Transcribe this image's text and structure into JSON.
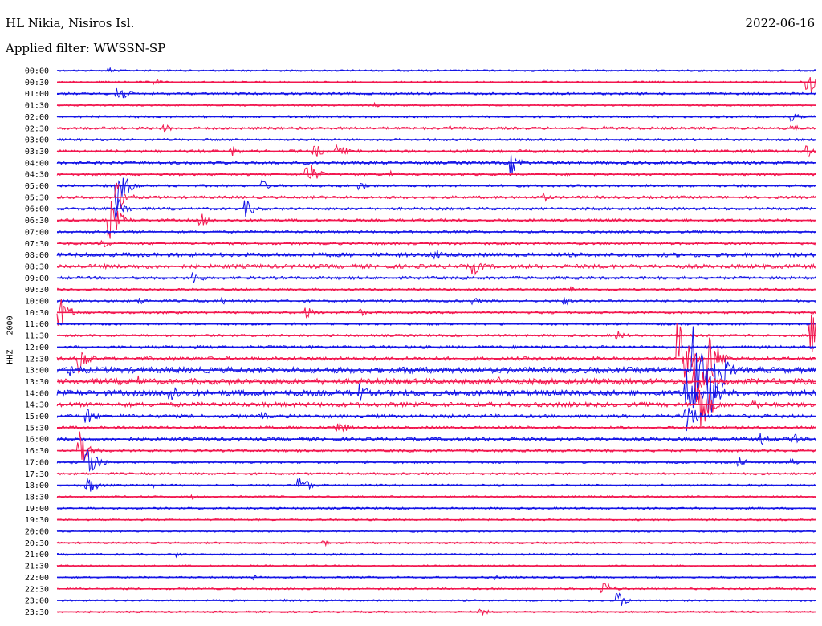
{
  "header": {
    "station": "HL Nikia, Nisiros Isl.",
    "date": "2022-06-16",
    "filter": "Applied filter: WWSSN-SP"
  },
  "colors": {
    "blue": "#1515e6",
    "red": "#f2174f"
  },
  "chart_data": {
    "type": "helicorder",
    "ylabel": "HHZ - 2000",
    "row_colors": [
      "blue",
      "red"
    ],
    "rows": [
      {
        "label": "00:00",
        "activity": 0.1,
        "events": [
          {
            "t": 0.07,
            "amp": 0.25
          }
        ]
      },
      {
        "label": "00:30",
        "activity": 0.12,
        "events": [
          {
            "t": 0.13,
            "amp": 0.25
          },
          {
            "t": 0.99,
            "amp": 1.6
          }
        ]
      },
      {
        "label": "01:00",
        "activity": 0.15,
        "events": [
          {
            "t": 0.08,
            "amp": 0.9
          }
        ]
      },
      {
        "label": "01:30",
        "activity": 0.1,
        "events": [
          {
            "t": 0.42,
            "amp": 0.2
          },
          {
            "t": 0.74,
            "amp": 0.15
          }
        ]
      },
      {
        "label": "02:00",
        "activity": 0.15,
        "events": [
          {
            "t": 0.97,
            "amp": 0.35
          }
        ]
      },
      {
        "label": "02:30",
        "activity": 0.18,
        "events": [
          {
            "t": 0.14,
            "amp": 0.4
          },
          {
            "t": 0.52,
            "amp": 0.2
          },
          {
            "t": 0.72,
            "amp": 0.2
          },
          {
            "t": 0.97,
            "amp": 0.3
          }
        ]
      },
      {
        "label": "03:00",
        "activity": 0.15,
        "events": []
      },
      {
        "label": "03:30",
        "activity": 0.22,
        "events": [
          {
            "t": 0.23,
            "amp": 0.5
          },
          {
            "t": 0.34,
            "amp": 0.6
          },
          {
            "t": 0.37,
            "amp": 0.6
          },
          {
            "t": 0.99,
            "amp": 0.5
          }
        ]
      },
      {
        "label": "04:00",
        "activity": 0.22,
        "events": [
          {
            "t": 0.6,
            "amp": 0.9
          }
        ]
      },
      {
        "label": "04:30",
        "activity": 0.18,
        "events": [
          {
            "t": 0.16,
            "amp": 0.2
          },
          {
            "t": 0.33,
            "amp": 1.2
          },
          {
            "t": 0.44,
            "amp": 0.3
          }
        ]
      },
      {
        "label": "05:00",
        "activity": 0.18,
        "events": [
          {
            "t": 0.08,
            "amp": 2.0
          },
          {
            "t": 0.27,
            "amp": 0.5
          },
          {
            "t": 0.4,
            "amp": 0.35
          }
        ]
      },
      {
        "label": "05:30",
        "activity": 0.2,
        "events": [
          {
            "t": 0.08,
            "amp": 1.4
          },
          {
            "t": 0.64,
            "amp": 0.4
          }
        ]
      },
      {
        "label": "06:00",
        "activity": 0.2,
        "events": [
          {
            "t": 0.08,
            "amp": 0.9
          },
          {
            "t": 0.25,
            "amp": 0.7
          }
        ]
      },
      {
        "label": "06:30",
        "activity": 0.22,
        "events": [
          {
            "t": 0.07,
            "amp": 1.9
          },
          {
            "t": 0.19,
            "amp": 0.6
          }
        ]
      },
      {
        "label": "07:00",
        "activity": 0.16,
        "events": []
      },
      {
        "label": "07:30",
        "activity": 0.2,
        "events": [
          {
            "t": 0.06,
            "amp": 0.4
          }
        ]
      },
      {
        "label": "08:00",
        "activity": 0.35,
        "events": [
          {
            "t": 0.5,
            "amp": 0.5
          }
        ]
      },
      {
        "label": "08:30",
        "activity": 0.35,
        "events": [
          {
            "t": 0.55,
            "amp": 0.7
          }
        ]
      },
      {
        "label": "09:00",
        "activity": 0.22,
        "events": [
          {
            "t": 0.18,
            "amp": 0.6
          }
        ]
      },
      {
        "label": "09:30",
        "activity": 0.15,
        "events": [
          {
            "t": 0.68,
            "amp": 0.2
          }
        ]
      },
      {
        "label": "10:00",
        "activity": 0.15,
        "events": [
          {
            "t": 0.11,
            "amp": 0.3
          },
          {
            "t": 0.22,
            "amp": 0.3
          },
          {
            "t": 0.55,
            "amp": 0.3
          },
          {
            "t": 0.67,
            "amp": 0.35
          }
        ]
      },
      {
        "label": "10:30",
        "activity": 0.18,
        "events": [
          {
            "t": 0.005,
            "amp": 1.3
          },
          {
            "t": 0.33,
            "amp": 0.5
          },
          {
            "t": 0.4,
            "amp": 0.3
          }
        ]
      },
      {
        "label": "11:00",
        "activity": 0.16,
        "events": []
      },
      {
        "label": "11:30",
        "activity": 0.16,
        "events": [
          {
            "t": 0.74,
            "amp": 0.4
          },
          {
            "t": 0.995,
            "amp": 1.8
          }
        ]
      },
      {
        "label": "12:00",
        "activity": 0.22,
        "events": []
      },
      {
        "label": "12:30",
        "activity": 0.3,
        "events": [
          {
            "t": 0.03,
            "amp": 1.2
          },
          {
            "t": 0.82,
            "amp": 3.2
          },
          {
            "t": 0.86,
            "amp": 2.8
          }
        ]
      },
      {
        "label": "13:00",
        "activity": 0.55,
        "events": [
          {
            "t": 0.02,
            "amp": 0.8
          },
          {
            "t": 0.46,
            "amp": 0.6
          },
          {
            "t": 0.84,
            "amp": 3.5
          },
          {
            "t": 0.87,
            "amp": 3.0
          }
        ]
      },
      {
        "label": "13:30",
        "activity": 0.55,
        "events": [
          {
            "t": 0.11,
            "amp": 0.5
          },
          {
            "t": 0.58,
            "amp": 0.5
          },
          {
            "t": 0.84,
            "amp": 2.2
          }
        ]
      },
      {
        "label": "14:00",
        "activity": 0.55,
        "events": [
          {
            "t": 0.15,
            "amp": 0.9
          },
          {
            "t": 0.4,
            "amp": 0.8
          },
          {
            "t": 0.83,
            "amp": 2.6
          },
          {
            "t": 0.86,
            "amp": 2.0
          }
        ]
      },
      {
        "label": "14:30",
        "activity": 0.4,
        "events": [
          {
            "t": 0.85,
            "amp": 2.2
          },
          {
            "t": 0.92,
            "amp": 0.5
          }
        ]
      },
      {
        "label": "15:00",
        "activity": 0.28,
        "events": [
          {
            "t": 0.04,
            "amp": 0.7
          },
          {
            "t": 0.27,
            "amp": 0.4
          },
          {
            "t": 0.83,
            "amp": 1.5
          }
        ]
      },
      {
        "label": "15:30",
        "activity": 0.22,
        "events": [
          {
            "t": 0.37,
            "amp": 0.7
          }
        ]
      },
      {
        "label": "16:00",
        "activity": 0.3,
        "events": [
          {
            "t": 0.93,
            "amp": 0.5
          },
          {
            "t": 0.97,
            "amp": 0.5
          }
        ]
      },
      {
        "label": "16:30",
        "activity": 0.2,
        "events": [
          {
            "t": 0.03,
            "amp": 1.6
          }
        ]
      },
      {
        "label": "17:00",
        "activity": 0.18,
        "events": [
          {
            "t": 0.04,
            "amp": 1.6
          },
          {
            "t": 0.9,
            "amp": 0.4
          },
          {
            "t": 0.97,
            "amp": 0.3
          }
        ]
      },
      {
        "label": "17:30",
        "activity": 0.15,
        "events": []
      },
      {
        "label": "18:00",
        "activity": 0.14,
        "events": [
          {
            "t": 0.04,
            "amp": 0.9
          },
          {
            "t": 0.13,
            "amp": 0.2
          },
          {
            "t": 0.32,
            "amp": 0.9
          }
        ]
      },
      {
        "label": "18:30",
        "activity": 0.12,
        "events": [
          {
            "t": 0.18,
            "amp": 0.2
          }
        ]
      },
      {
        "label": "19:00",
        "activity": 0.12,
        "events": []
      },
      {
        "label": "19:30",
        "activity": 0.1,
        "events": []
      },
      {
        "label": "20:00",
        "activity": 0.1,
        "events": []
      },
      {
        "label": "20:30",
        "activity": 0.1,
        "events": [
          {
            "t": 0.35,
            "amp": 0.3
          }
        ]
      },
      {
        "label": "21:00",
        "activity": 0.12,
        "events": [
          {
            "t": 0.16,
            "amp": 0.2
          }
        ]
      },
      {
        "label": "21:30",
        "activity": 0.1,
        "events": []
      },
      {
        "label": "22:00",
        "activity": 0.1,
        "events": [
          {
            "t": 0.26,
            "amp": 0.2
          },
          {
            "t": 0.58,
            "amp": 0.2
          }
        ]
      },
      {
        "label": "22:30",
        "activity": 0.1,
        "events": [
          {
            "t": 0.72,
            "amp": 0.7
          }
        ]
      },
      {
        "label": "23:00",
        "activity": 0.1,
        "events": [
          {
            "t": 0.3,
            "amp": 0.2
          },
          {
            "t": 0.74,
            "amp": 0.7
          }
        ]
      },
      {
        "label": "23:30",
        "activity": 0.1,
        "events": [
          {
            "t": 0.56,
            "amp": 0.3
          }
        ]
      }
    ]
  }
}
